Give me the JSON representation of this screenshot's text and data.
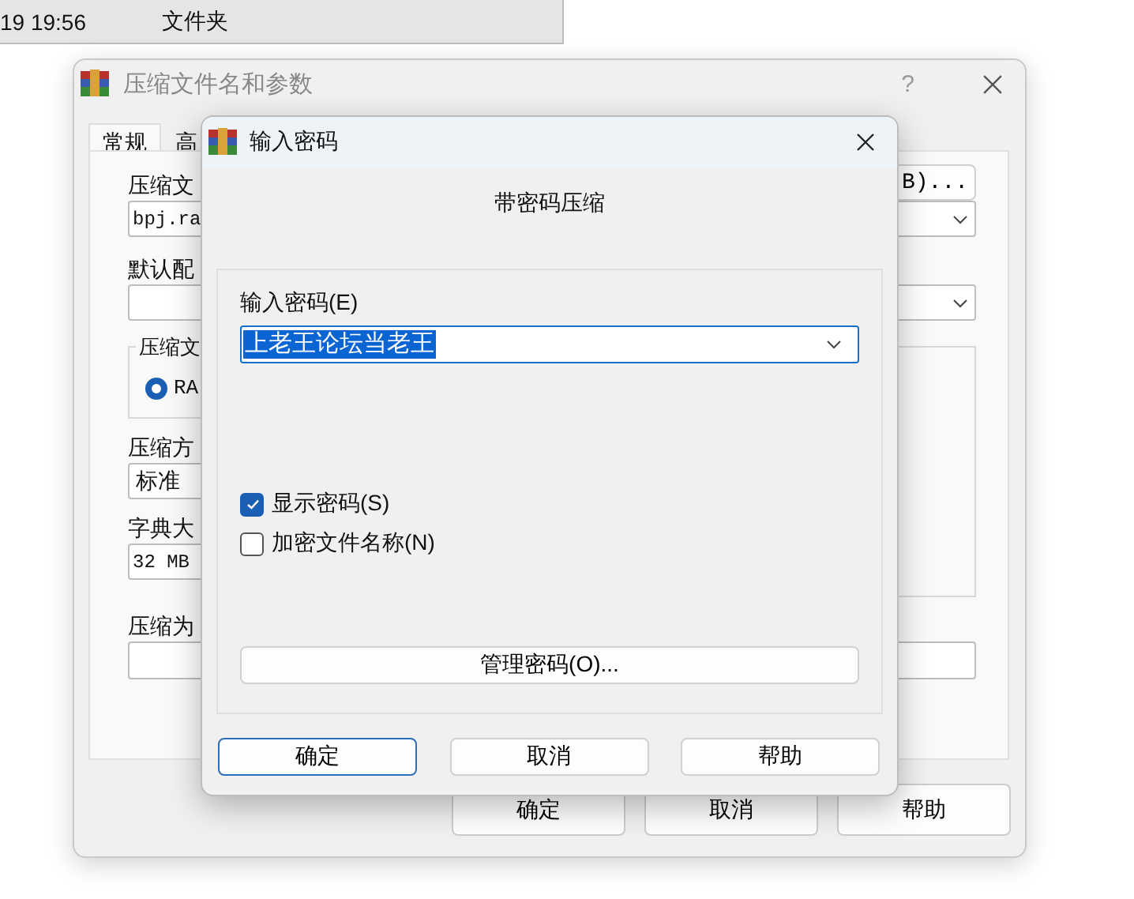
{
  "file_list_row": {
    "date": "19 19:56",
    "type": "文件夹"
  },
  "archive_window": {
    "title": "压缩文件名和参数",
    "help": "?",
    "tabs": [
      {
        "label": "常规",
        "selected": true
      },
      {
        "label": "高",
        "selected": false
      }
    ],
    "archive_name": {
      "label": "压缩文",
      "value": "bpj.ra"
    },
    "browse_button": "B)...",
    "profile": {
      "label": "默认配"
    },
    "format_group": {
      "label": "压缩文",
      "option": {
        "label": "RA",
        "selected": true
      }
    },
    "method": {
      "label": "压缩方",
      "value": "标准"
    },
    "dictionary": {
      "label": "字典大",
      "value": "32 MB"
    },
    "split": {
      "label": "压缩为"
    },
    "buttons": [
      {
        "label": "确定"
      },
      {
        "label": "取消"
      },
      {
        "label": "帮助"
      }
    ]
  },
  "password_dialog": {
    "title": "输入密码",
    "heading": "带密码压缩",
    "password": {
      "label": "输入密码(E)",
      "value": "上老王论坛当老王",
      "text_selected": true
    },
    "options": [
      {
        "label": "显示密码(S)",
        "checked": true
      },
      {
        "label": "加密文件名称(N)",
        "checked": false
      }
    ],
    "manage_button": "管理密码(O)...",
    "buttons": [
      {
        "label": "确定",
        "default": true
      },
      {
        "label": "取消",
        "default": false
      },
      {
        "label": "帮助",
        "default": false
      }
    ]
  }
}
